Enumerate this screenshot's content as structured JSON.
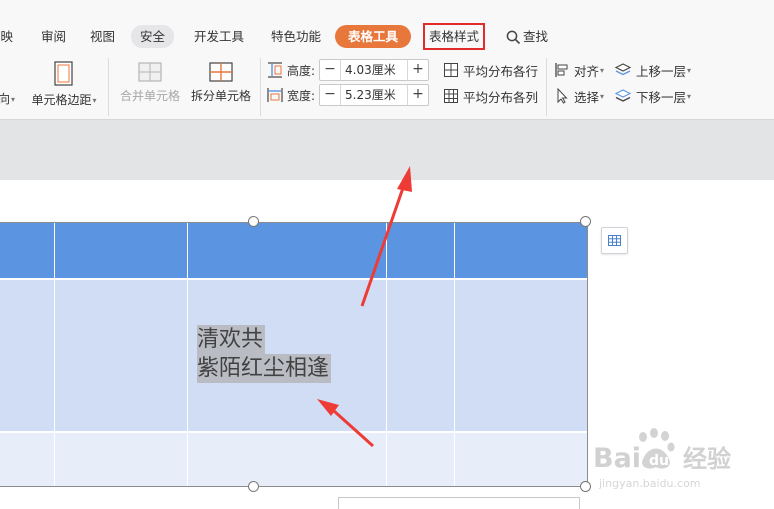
{
  "ribbon": {
    "tabs": [
      {
        "label": "放映"
      },
      {
        "label": "审阅"
      },
      {
        "label": "视图"
      },
      {
        "label": "安全"
      },
      {
        "label": "开发工具"
      },
      {
        "label": "特色功能"
      },
      {
        "label": "表格工具"
      },
      {
        "label": "表格样式"
      },
      {
        "label": "查找"
      }
    ],
    "groups": {
      "direction_label": "向",
      "cell_margin_label": "单元格边距",
      "merge_label": "合并单元格",
      "split_label": "拆分单元格",
      "height_label": "高度:",
      "height_value": "4.03厘米",
      "width_label": "宽度:",
      "width_value": "5.23厘米",
      "minus": "−",
      "plus": "+",
      "distribute_rows": "平均分布各行",
      "distribute_cols": "平均分布各列",
      "align_label": "对齐",
      "select_label": "选择",
      "bring_forward": "上移一层",
      "send_backward": "下移一层"
    }
  },
  "document": {
    "cell_text_line1": "清欢共",
    "cell_text_line2": "紫陌红尘相逢"
  },
  "watermark": {
    "brand": "Bai",
    "brand_suffix": "经验",
    "url": "jingyan.baidu.com"
  },
  "colors": {
    "header_row": "#5b95e2",
    "body_row": "#d1dcf5",
    "light_row": "#e7edf9",
    "accent_tab": "#e8773b",
    "highlight_box": "#e22c2c",
    "arrow": "#ee3b36"
  }
}
